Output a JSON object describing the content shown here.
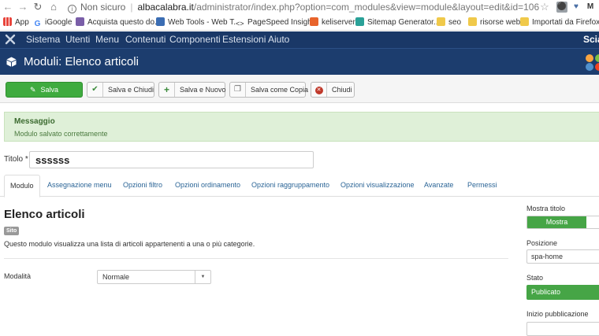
{
  "browser": {
    "security_label": "Non sicuro",
    "url_domain": "albacalabra.it",
    "url_path": "/administrator/index.php?option=com_modules&view=module&layout=edit&id=106",
    "bookmarks": [
      {
        "label": "App",
        "color": "#e8453c"
      },
      {
        "label": "iGoogle",
        "color": "#4285f4"
      },
      {
        "label": "Acquista questo do...",
        "color": "#7a5ea8"
      },
      {
        "label": "Web Tools - Web T...",
        "color": "#3b6db3"
      },
      {
        "label": "PageSpeed Insights",
        "color": "#333333"
      },
      {
        "label": "keliserver",
        "color": "#e8642c"
      },
      {
        "label": "Sitemap Generator...",
        "color": "#2aa198"
      },
      {
        "label": "seo",
        "color": "#f0c94a"
      },
      {
        "label": "risorse web",
        "color": "#f0c94a"
      },
      {
        "label": "Importati da Firefox",
        "color": "#f0c94a"
      }
    ]
  },
  "admin_nav": {
    "items": [
      "Sistema",
      "Utenti",
      "Menu",
      "Contenuti",
      "Componenti",
      "Estensioni",
      "Aiuto"
    ],
    "right_text": "Scia"
  },
  "page": {
    "title": "Moduli: Elenco articoli"
  },
  "toolbar": {
    "save_label": "Salva",
    "save_close_label": "Salva e Chiudi",
    "save_new_label": "Salva e Nuovo",
    "save_copy_label": "Salva come Copia",
    "close_label": "Chiudi"
  },
  "message": {
    "heading": "Messaggio",
    "text": "Modulo salvato correttamente"
  },
  "title_field": {
    "label": "Titolo *",
    "value": "ssssss"
  },
  "tabs": [
    "Modulo",
    "Assegnazione menu",
    "Opzioni filtro",
    "Opzioni ordinamento",
    "Opzioni raggruppamento",
    "Opzioni visualizzazione",
    "Avanzate",
    "Permessi"
  ],
  "module": {
    "heading": "Elenco articoli",
    "badge": "Sito",
    "description": "Questo modulo visualizza una lista di articoli appartenenti a una o più categorie.",
    "mode_label": "Modalità",
    "mode_value": "Normale"
  },
  "sidebar": {
    "show_title_label": "Mostra titolo",
    "show_title_value": "Mostra",
    "position_label": "Posizione",
    "position_value": "spa-home",
    "state_label": "Stato",
    "state_value": "Publicato",
    "publish_start_label": "Inizio pubblicazione"
  },
  "colors": {
    "nav_bg": "#1a3867",
    "title_bg": "#1c3d6e",
    "save_green": "#3fab3f",
    "message_bg": "#dff0d8"
  }
}
